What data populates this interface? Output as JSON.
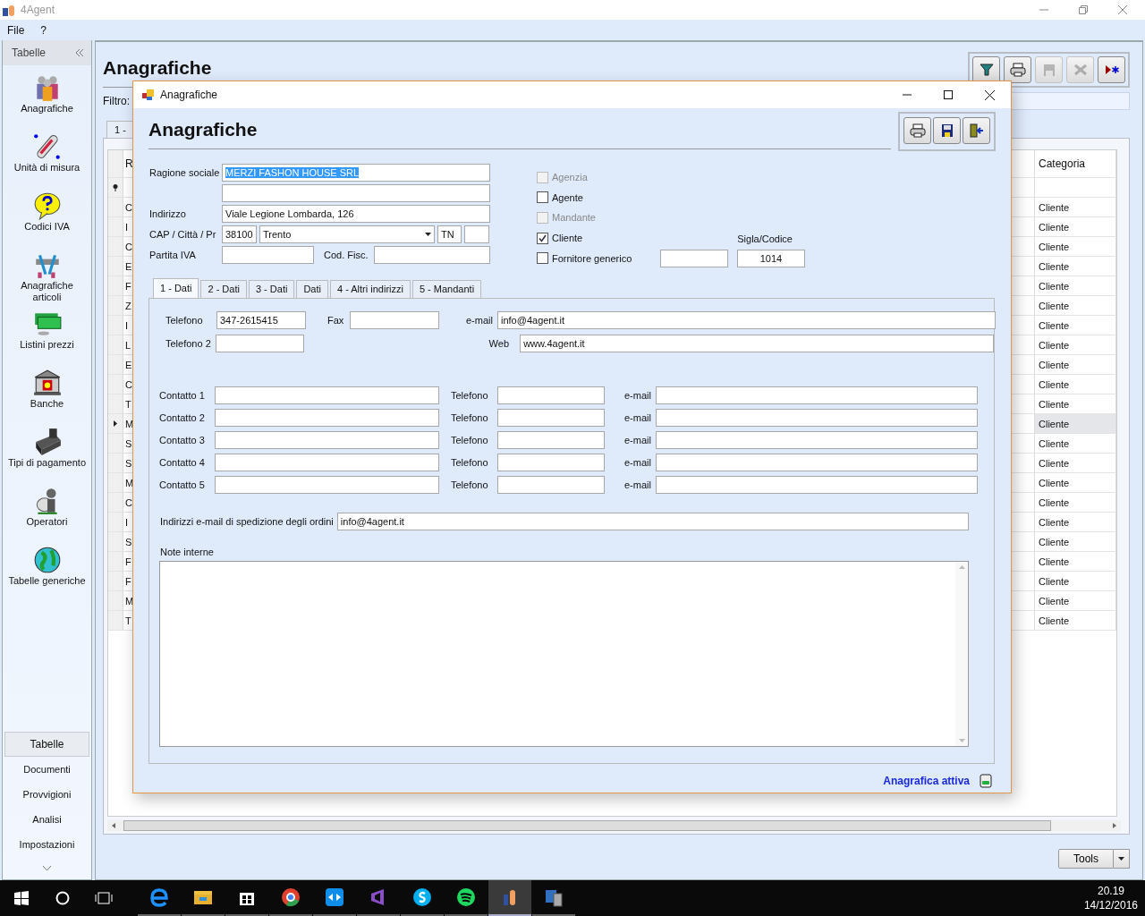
{
  "app": {
    "title": "4Agent",
    "menu": [
      "File",
      "?"
    ]
  },
  "sidebar": {
    "title": "Tabelle",
    "items": [
      "Anagrafiche",
      "Unità di misura",
      "Codici IVA",
      "Anagrafiche articoli",
      "Listini prezzi",
      "Banche",
      "Tipi di pagamento",
      "Operatori",
      "Tabelle generiche"
    ],
    "sections": [
      {
        "label": "Tabelle",
        "selected": true
      },
      {
        "label": "Documenti",
        "selected": false
      },
      {
        "label": "Provvigioni",
        "selected": false
      },
      {
        "label": "Analisi",
        "selected": false
      },
      {
        "label": "Impostazioni",
        "selected": false
      }
    ]
  },
  "main": {
    "title": "Anagrafiche",
    "toolbar": [
      {
        "disabled": false
      },
      {
        "disabled": false
      },
      {
        "disabled": true
      },
      {
        "disabled": true
      },
      {
        "disabled": false
      }
    ],
    "filter_label": "Filtro:",
    "tab": "1 -",
    "grid": {
      "column_1": "R",
      "column_2": "Categoria",
      "rows": [
        {
          "column_1": "C",
          "column_2": "Cliente",
          "selected": false
        },
        {
          "column_1": "I",
          "column_2": "Cliente",
          "selected": false
        },
        {
          "column_1": "C",
          "column_2": "Cliente",
          "selected": false
        },
        {
          "column_1": "E",
          "column_2": "Cliente",
          "selected": false
        },
        {
          "column_1": "F",
          "column_2": "Cliente",
          "selected": false
        },
        {
          "column_1": "Z",
          "column_2": "Cliente",
          "selected": false
        },
        {
          "column_1": "I",
          "column_2": "Cliente",
          "selected": false
        },
        {
          "column_1": "L",
          "column_2": "Cliente",
          "selected": false
        },
        {
          "column_1": "E",
          "column_2": "Cliente",
          "selected": false
        },
        {
          "column_1": "C",
          "column_2": "Cliente",
          "selected": false
        },
        {
          "column_1": "T",
          "column_2": "Cliente",
          "selected": false
        },
        {
          "column_1": "M",
          "column_2": "Cliente",
          "selected": true
        },
        {
          "column_1": "S",
          "column_2": "Cliente",
          "selected": false
        },
        {
          "column_1": "S",
          "column_2": "Cliente",
          "selected": false
        },
        {
          "column_1": "M",
          "column_2": "Cliente",
          "selected": false
        },
        {
          "column_1": "C",
          "column_2": "Cliente",
          "selected": false
        },
        {
          "column_1": "I",
          "column_2": "Cliente",
          "selected": false
        },
        {
          "column_1": "S",
          "column_2": "Cliente",
          "selected": false
        },
        {
          "column_1": "F",
          "column_2": "Cliente",
          "selected": false
        },
        {
          "column_1": "F",
          "column_2": "Cliente",
          "selected": false
        },
        {
          "column_1": "M",
          "column_2": "Cliente",
          "selected": false
        },
        {
          "column_1": "T",
          "column_2": "Cliente",
          "selected": false
        }
      ]
    },
    "tools_button": "Tools"
  },
  "dialog": {
    "title": "Anagrafiche",
    "heading": "Anagrafiche",
    "fields": {
      "ragione_sociale_label": "Ragione sociale",
      "ragione_sociale": {
        "value": "MERZI FASHON HOUSE SRL",
        "selected": true
      },
      "indirizzo_label": "Indirizzo",
      "indirizzo": "Viale Legione Lombarda, 126",
      "cap_label": "CAP / Città / Pr",
      "cap": "38100",
      "citta": "Trento",
      "provincia": "TN",
      "partita_iva_label": "Partita IVA",
      "cod_fisc_label": "Cod. Fisc."
    },
    "checkboxes": [
      {
        "label": "Agenzia",
        "checked": false,
        "disabled": true
      },
      {
        "label": "Agente",
        "checked": false,
        "disabled": false
      },
      {
        "label": "Mandante",
        "checked": false,
        "disabled": true
      },
      {
        "label": "Cliente",
        "checked": true,
        "disabled": false
      },
      {
        "label": "Fornitore generico",
        "checked": false,
        "disabled": false
      }
    ],
    "sigla_label": "Sigla/Codice",
    "sigla": "1014",
    "tabs": [
      {
        "label": "1 - Dati",
        "selected": true
      },
      {
        "label": "2 - Dati",
        "selected": false
      },
      {
        "label": "3 - Dati",
        "selected": false
      },
      {
        "label": "Dati",
        "selected": false
      },
      {
        "label": "4 - Altri indirizzi",
        "selected": false
      },
      {
        "label": "5 - Mandanti",
        "selected": false
      }
    ],
    "contact": {
      "telefono_label": "Telefono",
      "telefono": "347-2615415",
      "fax_label": "Fax",
      "email_label": "e-mail",
      "email": "info@4agent.it",
      "telefono2_label": "Telefono 2",
      "web_label": "Web",
      "web": "www.4agent.it"
    },
    "contacts": [
      {
        "label": "Contatto 1",
        "phone_label": "Telefono",
        "email_label": "e-mail"
      },
      {
        "label": "Contatto 2",
        "phone_label": "Telefono",
        "email_label": "e-mail"
      },
      {
        "label": "Contatto 3",
        "phone_label": "Telefono",
        "email_label": "e-mail"
      },
      {
        "label": "Contatto 4",
        "phone_label": "Telefono",
        "email_label": "e-mail"
      },
      {
        "label": "Contatto 5",
        "phone_label": "Telefono",
        "email_label": "e-mail"
      }
    ],
    "order_email_label": "Indirizzi e-mail di spedizione degli ordini",
    "order_email": "info@4agent.it",
    "notes_label": "Note interne",
    "status": "Anagrafica attiva"
  },
  "taskbar": {
    "apps": [
      {
        "selected": false
      },
      {
        "selected": false
      },
      {
        "selected": false
      },
      {
        "selected": false
      },
      {
        "selected": false
      },
      {
        "selected": false
      },
      {
        "selected": false
      },
      {
        "selected": false
      },
      {
        "selected": true
      },
      {
        "selected": false
      }
    ],
    "time": "20.19",
    "date": "14/12/2016"
  }
}
